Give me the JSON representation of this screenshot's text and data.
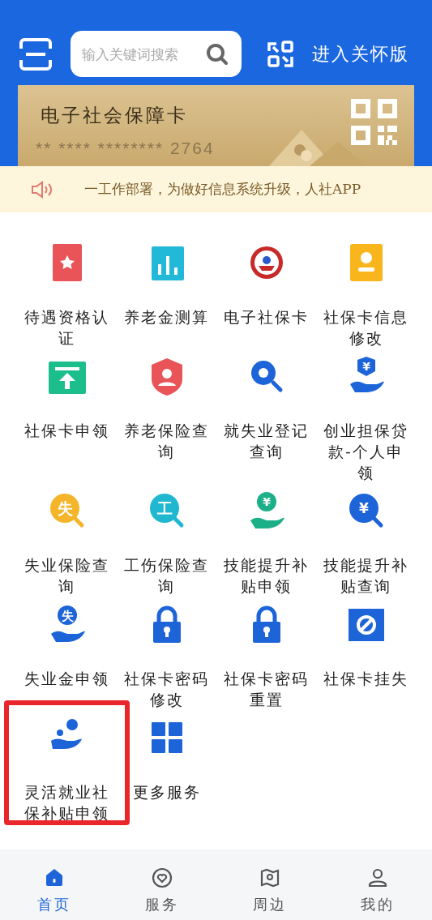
{
  "header": {
    "search": {
      "placeholder": "输入关键词搜索"
    },
    "care_mode_link": "进入关怀版"
  },
  "card": {
    "title": "电子社会保障卡",
    "number": "** **** ******** 2764"
  },
  "notice": {
    "text": "一工作部署，为做好信息系统升级，人社APP"
  },
  "services": [
    {
      "label": "待遇资格认证",
      "highlighted": false
    },
    {
      "label": "养老金测算",
      "highlighted": false
    },
    {
      "label": "电子社保卡",
      "highlighted": false
    },
    {
      "label": "社保卡信息修改",
      "highlighted": false
    },
    {
      "label": "社保卡申领",
      "highlighted": false
    },
    {
      "label": "养老保险查询",
      "highlighted": false
    },
    {
      "label": "就失业登记查询",
      "highlighted": false
    },
    {
      "label": "创业担保贷款-个人申领",
      "glyph": "¥",
      "highlighted": false
    },
    {
      "label": "失业保险查询",
      "glyph": "失",
      "highlighted": false
    },
    {
      "label": "工伤保险查询",
      "glyph": "工",
      "highlighted": false
    },
    {
      "label": "技能提升补贴申领",
      "glyph": "¥",
      "highlighted": false
    },
    {
      "label": "技能提升补贴查询",
      "glyph": "¥",
      "highlighted": false
    },
    {
      "label": "失业金申领",
      "glyph": "失",
      "highlighted": false
    },
    {
      "label": "社保卡密码修改",
      "highlighted": false
    },
    {
      "label": "社保卡密码重置",
      "highlighted": false
    },
    {
      "label": "社保卡挂失",
      "highlighted": false
    },
    {
      "label": "灵活就业社保补贴申领",
      "highlighted": true
    },
    {
      "label": "更多服务",
      "highlighted": false
    }
  ],
  "tabs": [
    {
      "label": "首页",
      "selected": true
    },
    {
      "label": "服务",
      "selected": false
    },
    {
      "label": "周边",
      "selected": false
    },
    {
      "label": "我的",
      "selected": false
    }
  ]
}
